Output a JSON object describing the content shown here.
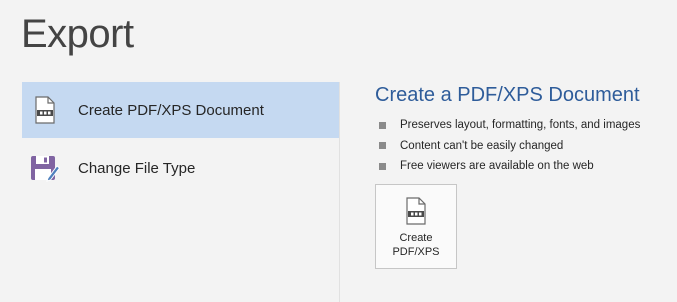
{
  "page": {
    "title": "Export"
  },
  "options": [
    {
      "label": "Create PDF/XPS Document",
      "icon": "pdf-document-icon",
      "selected": true
    },
    {
      "label": "Change File Type",
      "icon": "save-as-icon",
      "selected": false
    }
  ],
  "details": {
    "title": "Create a PDF/XPS Document",
    "bullets": [
      "Preserves layout, formatting, fonts, and images",
      "Content can't be easily changed",
      "Free viewers are available on the web"
    ],
    "button": {
      "line1": "Create",
      "line2": "PDF/XPS",
      "icon": "pdf-document-icon"
    }
  },
  "colors": {
    "selected_background": "#c5d9f1",
    "title_accent": "#2e5c9a",
    "save_icon_purple": "#8064a2"
  }
}
